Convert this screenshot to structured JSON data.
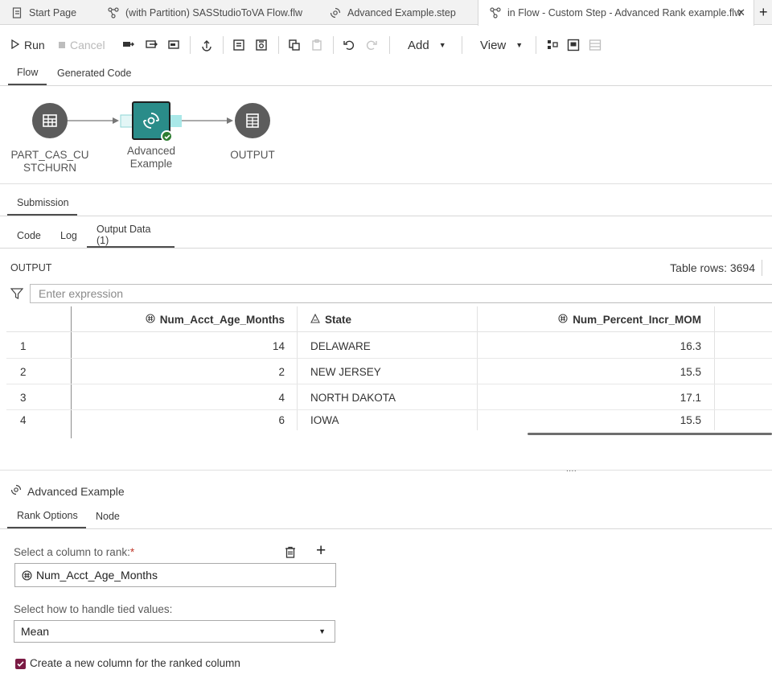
{
  "tabs": [
    {
      "label": "Start Page",
      "icon": "start-page-icon"
    },
    {
      "label": "(with Partition) SASStudioToVA Flow.flw",
      "icon": "flow-icon"
    },
    {
      "label": "Advanced Example.step",
      "icon": "custom-step-icon"
    },
    {
      "label": "in Flow - Custom Step - Advanced Rank example.flw",
      "icon": "flow-icon"
    }
  ],
  "toolbar": {
    "run_label": "Run",
    "cancel_label": "Cancel",
    "add_label": "Add",
    "view_label": "View"
  },
  "flow_tabs": [
    "Flow",
    "Generated Code"
  ],
  "flow": {
    "nodes": [
      {
        "label_line1": "PART_CAS_CU",
        "label_line2": "STCHURN",
        "icon": "table-icon"
      },
      {
        "label_line1": "Advanced",
        "label_line2": "Example",
        "icon": "custom-step-icon"
      },
      {
        "label_line1": "OUTPUT",
        "label_line2": "",
        "icon": "output-table-icon"
      }
    ]
  },
  "submission_tab": "Submission",
  "result_tabs": [
    "Code",
    "Log",
    "Output Data (1)"
  ],
  "output": {
    "table_name": "OUTPUT",
    "table_rows": "Table rows: 3694",
    "filter_placeholder": "Enter expression",
    "columns": [
      {
        "name": "Num_Acct_Age_Months",
        "type_icon": "numeric-icon"
      },
      {
        "name": "State",
        "type_icon": "character-icon"
      },
      {
        "name": "Num_Percent_Incr_MOM",
        "type_icon": "numeric-icon"
      }
    ],
    "rows": [
      {
        "n": "1",
        "age": "14",
        "state": "DELAWARE",
        "pct": "16.3"
      },
      {
        "n": "2",
        "age": "2",
        "state": "NEW JERSEY",
        "pct": "15.5"
      },
      {
        "n": "3",
        "age": "4",
        "state": "NORTH DAKOTA",
        "pct": "17.1"
      },
      {
        "n": "4",
        "age": "6",
        "state": "IOWA",
        "pct": "15.5"
      }
    ]
  },
  "step_panel": {
    "title": "Advanced Example",
    "tabs": [
      "Rank Options",
      "Node"
    ],
    "column_label": "Select a column to rank:",
    "required_marker": "*",
    "column_value": "Num_Acct_Age_Months",
    "ties_label": "Select how to handle tied values:",
    "ties_value": "Mean",
    "checkbox_label": "Create a new column for the ranked column",
    "checkbox_checked": true
  },
  "colors": {
    "accent_node": "#2a8c89",
    "checkbox": "#7b1a44",
    "node_gray": "#5c5c5c",
    "success": "#2e7d32"
  }
}
